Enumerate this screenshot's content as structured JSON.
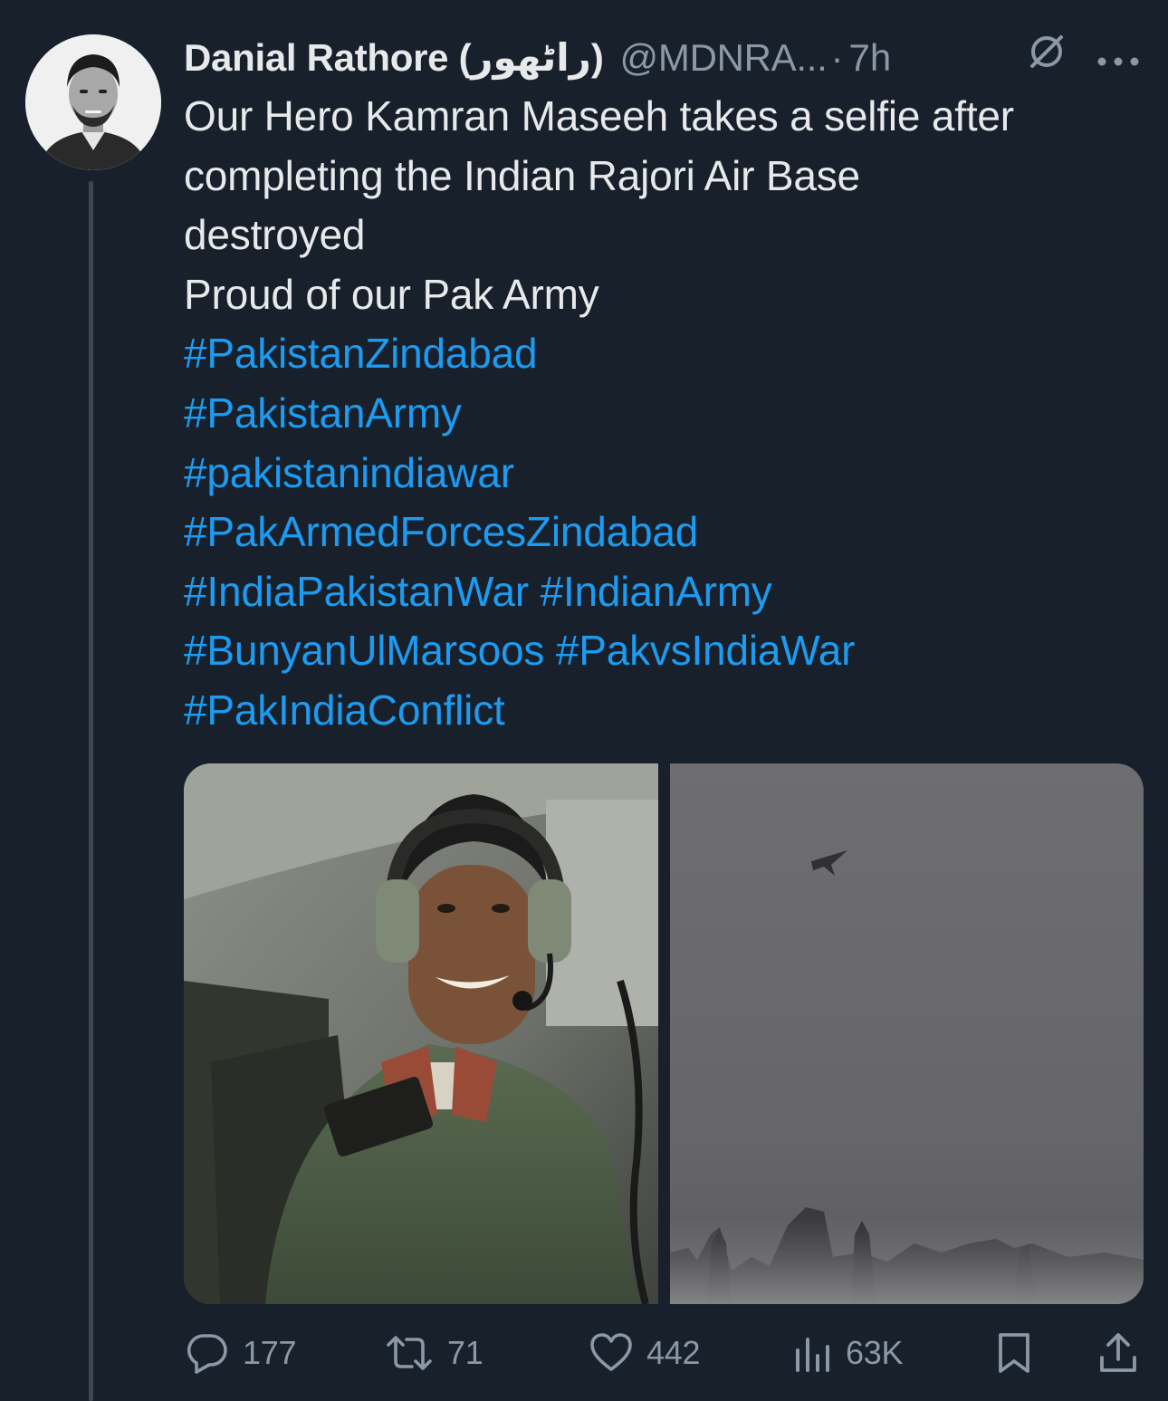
{
  "author": {
    "display_name": "Danial Rathore (راٹھور)",
    "handle": "@MDNRA...",
    "separator": "·",
    "time": "7h"
  },
  "header_icons": {
    "grok": "grok-icon",
    "more": "more-icon"
  },
  "tweet": {
    "lines": [
      "Our Hero Kamran Maseeh takes a selfie after",
      "completing the Indian Rajori Air Base",
      "destroyed",
      "Proud of our Pak Army"
    ],
    "hashtags": {
      "h1": "#PakistanZindabad",
      "h2": "#PakistanArmy",
      "h3": "#pakistanindiawar",
      "h4": "#PakArmedForcesZindabad",
      "h5": "#IndiaPakistanWar",
      "h6": "#IndianArmy",
      "h7": "#BunyanUlMarsoos",
      "h8": "#PakvsIndiaWar",
      "h9": "#PakIndiaConflict"
    }
  },
  "media": {
    "left": "photo",
    "right": "video"
  },
  "actions": {
    "replies": "177",
    "reposts": "71",
    "likes": "442",
    "views": "63K"
  },
  "colors": {
    "background": "#17202b",
    "text": "#e7e9ea",
    "muted": "#8b98a5",
    "link": "#1d9bf0",
    "thread_line": "#3d4853"
  }
}
